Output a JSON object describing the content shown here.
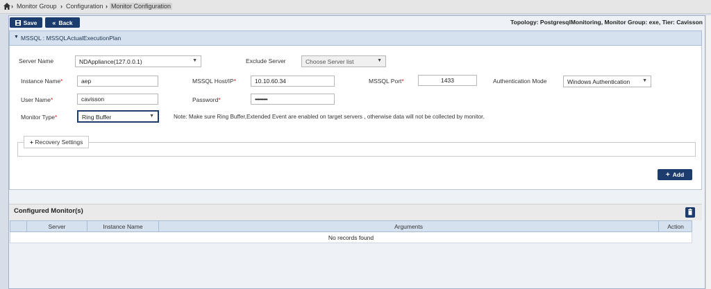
{
  "breadcrumb": {
    "items": [
      {
        "label": "Monitor Group"
      },
      {
        "label": "Configuration"
      },
      {
        "label": "Monitor Configuration"
      }
    ]
  },
  "toolbar": {
    "save_label": "Save",
    "back_label": "Back",
    "topology_info": "Topology: PostgresqlMonitoring, Monitor Group: exe, Tier: Cavisson"
  },
  "config_panel": {
    "title": "MSSQL : MSSQLActualExecutionPlan",
    "server_name": {
      "label": "Server Name",
      "value": "NDAppliance(127.0.0.1)"
    },
    "exclude_server": {
      "label": "Exclude Server",
      "placeholder": "Choose Server list"
    },
    "instance_name": {
      "label": "Instance Name",
      "value": "aep"
    },
    "host": {
      "label": "MSSQL Host/IP",
      "value": "10.10.60.34"
    },
    "port": {
      "label": "MSSQL Port",
      "value": "1433"
    },
    "auth_mode": {
      "label": "Authentication Mode",
      "value": "Windows Authentication"
    },
    "user_name": {
      "label": "User Name",
      "value": "cavisson"
    },
    "password": {
      "label": "Password",
      "value": "•••••••••"
    },
    "monitor_type": {
      "label": "Monitor Type",
      "value": "Ring Buffer"
    },
    "note": "Note: Make sure Ring Buffer,Extended Event are enabled on target servers , otherwise data will not be collected by monitor.",
    "recovery_label": "Recovery Settings",
    "add_label": "Add",
    "required_mark": "*"
  },
  "configured": {
    "title": "Configured Monitor(s)",
    "columns": [
      "Server",
      "Instance Name",
      "Arguments",
      "Action"
    ],
    "empty_text": "No records found"
  },
  "colors": {
    "accent": "#1d3c6e",
    "header_bg": "#d5e1ef",
    "required": "#d21d1d"
  },
  "icons": [
    "home-icon",
    "chevron-right-icon",
    "save-icon",
    "back-icon",
    "caret-down-icon",
    "plus-icon",
    "trash-icon"
  ]
}
